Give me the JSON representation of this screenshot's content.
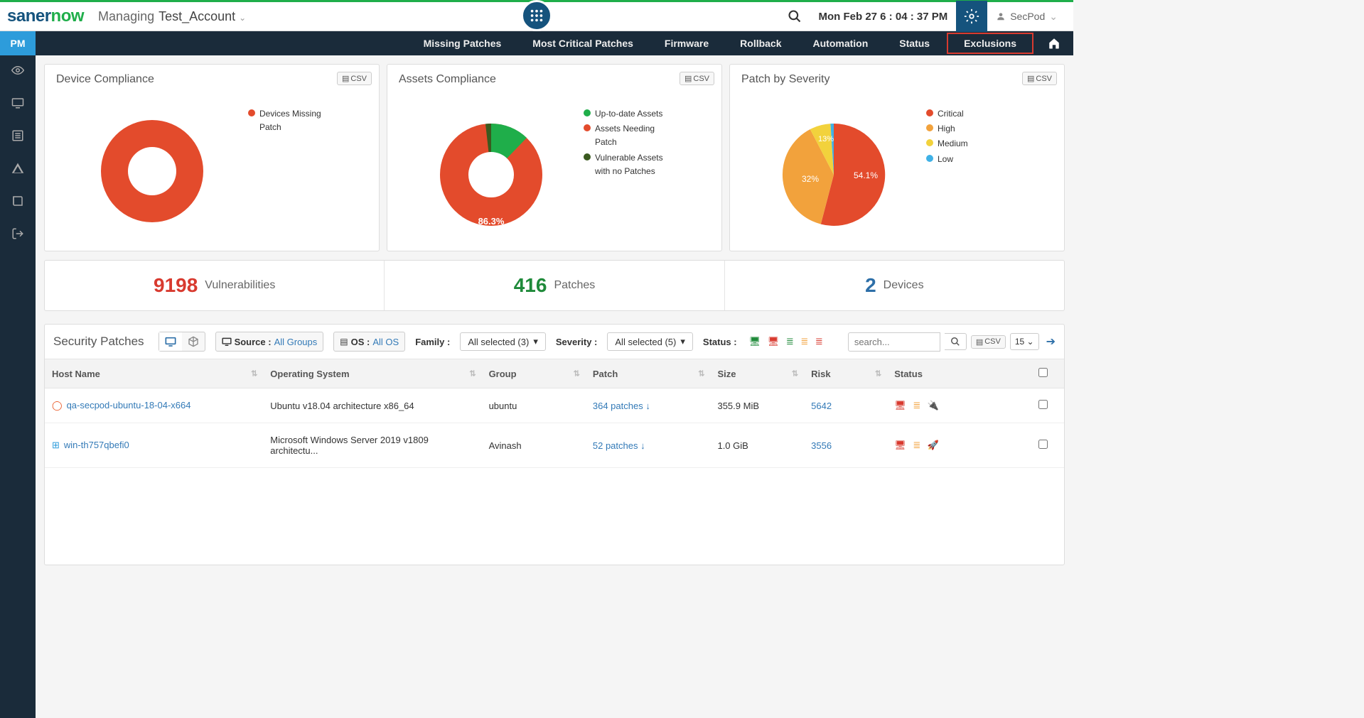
{
  "header": {
    "logo_a": "saner",
    "logo_b": "now",
    "managing": "Managing",
    "account": "Test_Account",
    "datetime": "Mon Feb 27  6 : 04 : 37 PM",
    "user": "SecPod"
  },
  "nav": {
    "badge": "PM",
    "items": [
      "Missing Patches",
      "Most Critical Patches",
      "Firmware",
      "Rollback",
      "Automation",
      "Status",
      "Exclusions"
    ]
  },
  "cards": {
    "device_compliance": {
      "title": "Device Compliance",
      "csv": "CSV",
      "legend": [
        "Devices Missing Patch"
      ]
    },
    "assets_compliance": {
      "title": "Assets Compliance",
      "csv": "CSV",
      "pct": "86.3%",
      "legend": [
        "Up-to-date Assets",
        "Assets Needing Patch",
        "Vulnerable Assets with no Patches"
      ]
    },
    "patch_severity": {
      "title": "Patch by Severity",
      "csv": "CSV",
      "slices": {
        "critical": "54.1%",
        "high": "32%",
        "medium": "13%"
      },
      "legend": [
        "Critical",
        "High",
        "Medium",
        "Low"
      ]
    }
  },
  "kpi": {
    "vuln_num": "9198",
    "vuln_lbl": "Vulnerabilities",
    "patch_num": "416",
    "patch_lbl": "Patches",
    "dev_num": "2",
    "dev_lbl": "Devices"
  },
  "toolbar": {
    "title": "Security Patches",
    "source_lbl": "Source :",
    "source_val": "All Groups",
    "os_lbl": "OS :",
    "os_val": "All OS",
    "family_lbl": "Family :",
    "family_val": "All selected (3)",
    "severity_lbl": "Severity :",
    "severity_val": "All selected (5)",
    "status_lbl": "Status :",
    "search_ph": "search...",
    "csv": "CSV",
    "pagesize": "15"
  },
  "table": {
    "cols": [
      "Host Name",
      "Operating System",
      "Group",
      "Patch",
      "Size",
      "Risk",
      "Status"
    ],
    "rows": [
      {
        "host": "qa-secpod-ubuntu-18-04-x664",
        "os": "Ubuntu v18.04 architecture x86_64",
        "group": "ubuntu",
        "patch": "364 patches",
        "size": "355.9 MiB",
        "risk": "5642",
        "os_type": "ubuntu"
      },
      {
        "host": "win-th757qbefi0",
        "os": "Microsoft Windows Server 2019 v1809 architectu...",
        "group": "Avinash",
        "patch": "52 patches",
        "size": "1.0 GiB",
        "risk": "3556",
        "os_type": "windows"
      }
    ]
  },
  "chart_data": [
    {
      "type": "pie",
      "title": "Device Compliance",
      "series": [
        {
          "name": "Devices Missing Patch",
          "value": 100,
          "color": "#e34b2c"
        }
      ]
    },
    {
      "type": "pie",
      "title": "Assets Compliance",
      "series": [
        {
          "name": "Up-to-date Assets",
          "value": 12,
          "color": "#1fae4a"
        },
        {
          "name": "Assets Needing Patch",
          "value": 86.3,
          "color": "#e34b2c"
        },
        {
          "name": "Vulnerable Assets with no Patches",
          "value": 1.7,
          "color": "#3a5a1f"
        }
      ]
    },
    {
      "type": "pie",
      "title": "Patch by Severity",
      "series": [
        {
          "name": "Critical",
          "value": 54.1,
          "color": "#e34b2c"
        },
        {
          "name": "High",
          "value": 32,
          "color": "#f2a23c"
        },
        {
          "name": "Medium",
          "value": 13,
          "color": "#f2d23c"
        },
        {
          "name": "Low",
          "value": 0.9,
          "color": "#3fb1e6"
        }
      ]
    }
  ]
}
